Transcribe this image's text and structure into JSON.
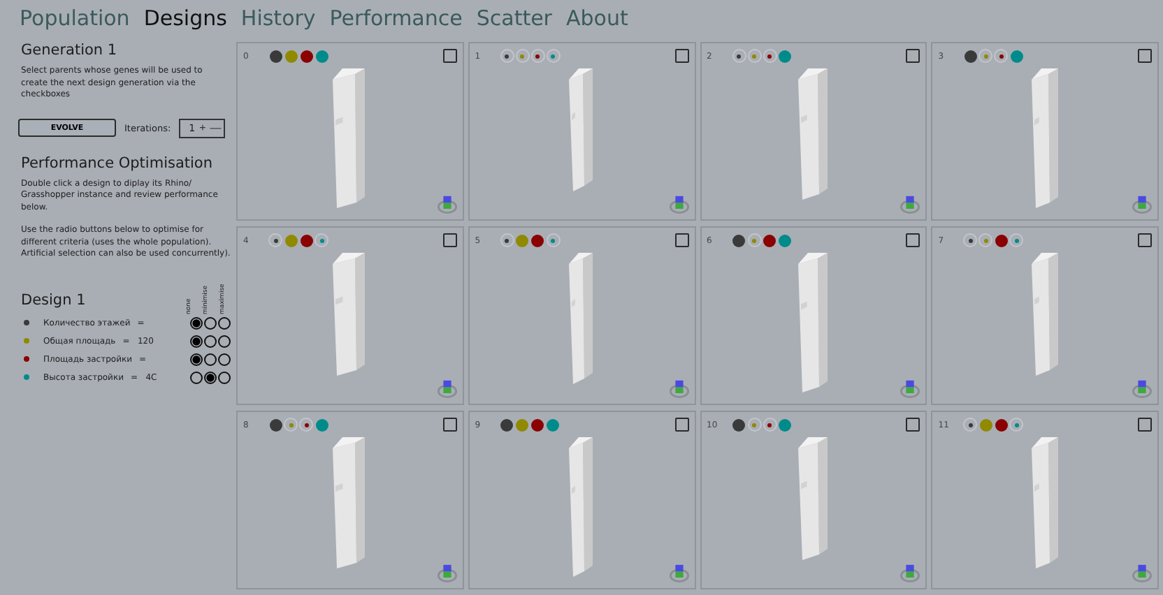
{
  "tabs": [
    {
      "label": "Population",
      "selected": false
    },
    {
      "label": "Designs",
      "selected": true
    },
    {
      "label": "History",
      "selected": false
    },
    {
      "label": "Performance",
      "selected": false
    },
    {
      "label": "Scatter",
      "selected": false
    },
    {
      "label": "About",
      "selected": false
    }
  ],
  "sidebar": {
    "generation_title": "Generation 1",
    "generation_text": "Select parents whose genes will be used to create the next design generation via the checkboxes",
    "evolve_button": "EVOLVE",
    "iterations_label": "Iterations:",
    "iterations_value": "1",
    "plus": "+",
    "minus": "—",
    "optimisation_title": "Performance Optimisation",
    "optimisation_text_1": "Double click a design to diplay its Rhino/ Grasshopper instance and review performance below.",
    "optimisation_text_2": "Use the radio buttons below to optimise for different criteria (uses the whole population). Artificial selection can also be used concurrently).",
    "design_title": "Design 1",
    "option_headers": [
      "none",
      "minimise",
      "maximise"
    ],
    "criteria": [
      {
        "label": "Количество этажей",
        "value": "=",
        "color": "#3a3a3a",
        "options": [
          {
            "selected": true
          },
          {
            "selected": false
          },
          {
            "selected": false
          }
        ]
      },
      {
        "label": "Общая площадь",
        "value": "=   120",
        "color": "#8f8a00",
        "options": [
          {
            "selected": true
          },
          {
            "selected": false
          },
          {
            "selected": false
          }
        ]
      },
      {
        "label": "Площадь застройки",
        "value": "=",
        "color": "#8b0000",
        "options": [
          {
            "selected": true
          },
          {
            "selected": false
          },
          {
            "selected": false
          }
        ]
      },
      {
        "label": "Высота застройки",
        "value": "=   4C",
        "color": "#008b8b",
        "options": [
          {
            "selected": false
          },
          {
            "selected": true
          },
          {
            "selected": false
          }
        ]
      }
    ]
  },
  "designs": [
    {
      "index": "0",
      "checked": false,
      "scores": [
        {
          "large": true
        },
        {
          "large": true
        },
        {
          "large": true
        },
        {
          "large": true
        }
      ]
    },
    {
      "index": "1",
      "checked": false,
      "scores": [
        {
          "large": false
        },
        {
          "large": false
        },
        {
          "large": false
        },
        {
          "large": false
        }
      ]
    },
    {
      "index": "2",
      "checked": false,
      "scores": [
        {
          "large": false
        },
        {
          "large": false
        },
        {
          "large": false
        },
        {
          "large": true
        }
      ]
    },
    {
      "index": "3",
      "checked": false,
      "scores": [
        {
          "large": true
        },
        {
          "large": false
        },
        {
          "large": false
        },
        {
          "large": true
        }
      ]
    },
    {
      "index": "4",
      "checked": false,
      "scores": [
        {
          "large": false
        },
        {
          "large": true
        },
        {
          "large": true
        },
        {
          "large": false
        }
      ]
    },
    {
      "index": "5",
      "checked": false,
      "scores": [
        {
          "large": false
        },
        {
          "large": true
        },
        {
          "large": true
        },
        {
          "large": false
        }
      ]
    },
    {
      "index": "6",
      "checked": false,
      "scores": [
        {
          "large": true
        },
        {
          "large": false
        },
        {
          "large": true
        },
        {
          "large": true
        }
      ]
    },
    {
      "index": "7",
      "checked": false,
      "scores": [
        {
          "large": false
        },
        {
          "large": false
        },
        {
          "large": true
        },
        {
          "large": false
        }
      ]
    },
    {
      "index": "8",
      "checked": false,
      "scores": [
        {
          "large": true
        },
        {
          "large": false
        },
        {
          "large": false
        },
        {
          "large": true
        }
      ]
    },
    {
      "index": "9",
      "checked": false,
      "scores": [
        {
          "large": true
        },
        {
          "large": true
        },
        {
          "large": true
        },
        {
          "large": true
        }
      ]
    },
    {
      "index": "10",
      "checked": false,
      "scores": [
        {
          "large": true
        },
        {
          "large": false
        },
        {
          "large": false
        },
        {
          "large": true
        }
      ]
    },
    {
      "index": "11",
      "checked": false,
      "scores": [
        {
          "large": false
        },
        {
          "large": true
        },
        {
          "large": true
        },
        {
          "large": false
        }
      ]
    }
  ]
}
